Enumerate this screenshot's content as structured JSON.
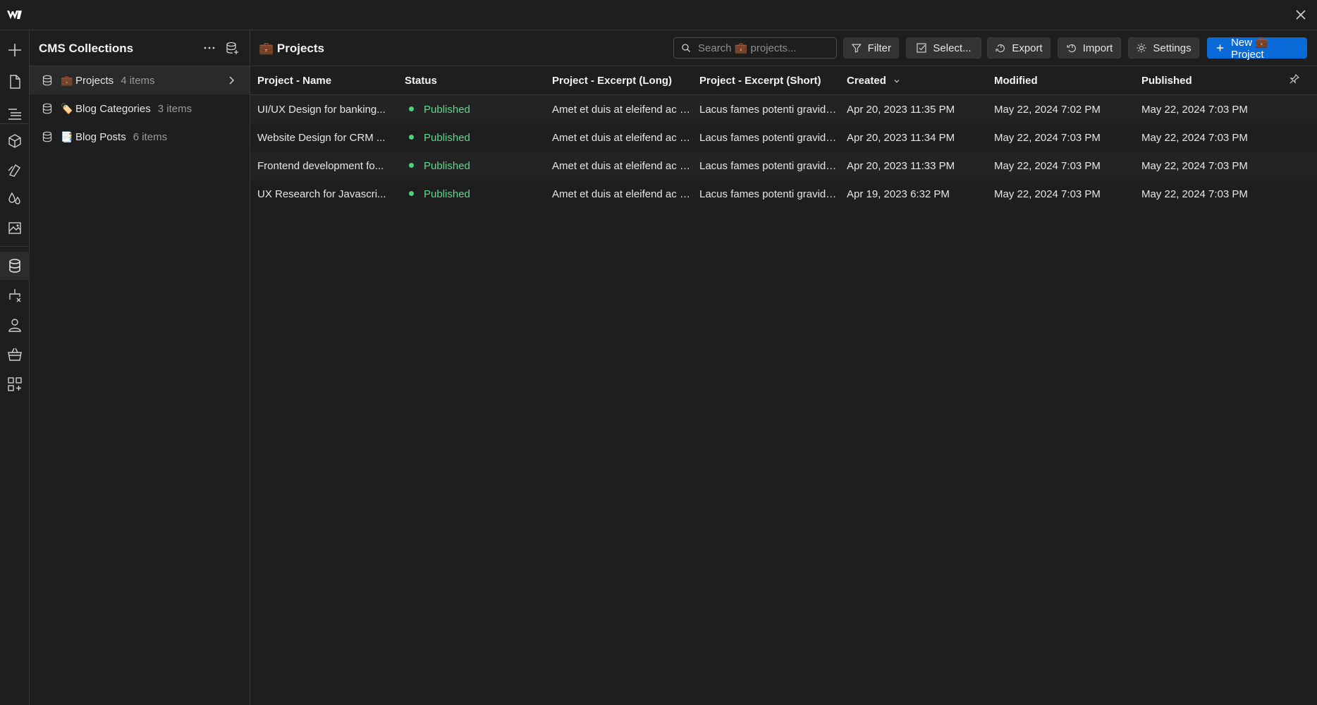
{
  "app": {
    "logo_text": "W",
    "colors": {
      "accent": "#0a6bd8",
      "status_published": "#4bd37b",
      "bg": "#1e1e1e"
    }
  },
  "rail": {
    "icons": [
      "add-icon",
      "page-icon",
      "navigator-icon",
      "components-icon",
      "style-icon",
      "variables-icon",
      "assets-icon",
      "cms-icon",
      "logic-icon",
      "users-icon",
      "ecommerce-icon",
      "apps-icon"
    ]
  },
  "collections": {
    "title": "CMS Collections",
    "items": [
      {
        "emoji": "💼",
        "name": "Projects",
        "count": "4 items"
      },
      {
        "emoji": "🏷️",
        "name": "Blog Categories",
        "count": "3 items"
      },
      {
        "emoji": "📑",
        "name": "Blog Posts",
        "count": "6 items"
      }
    ]
  },
  "main": {
    "title": "💼 Projects",
    "search_placeholder": "Search 💼 projects...",
    "buttons": {
      "filter": "Filter",
      "select": "Select...",
      "export": "Export",
      "import": "Import",
      "settings": "Settings",
      "new": "New 💼 Project"
    }
  },
  "table": {
    "columns": [
      "Project - Name",
      "Status",
      "Project - Excerpt (Long)",
      "Project - Excerpt (Short)",
      "Created",
      "Modified",
      "Published"
    ],
    "rows": [
      {
        "name": "UI/UX Design for banking...",
        "status": "Published",
        "excerpt_long": "Amet et duis at eleifend ac la...",
        "excerpt_short": "Lacus fames potenti gravida l...",
        "created": "Apr 20, 2023 11:35 PM",
        "modified": "May 22, 2024 7:02 PM",
        "published": "May 22, 2024 7:03 PM"
      },
      {
        "name": "Website Design for CRM ...",
        "status": "Published",
        "excerpt_long": "Amet et duis at eleifend ac la...",
        "excerpt_short": "Lacus fames potenti gravida l...",
        "created": "Apr 20, 2023 11:34 PM",
        "modified": "May 22, 2024 7:03 PM",
        "published": "May 22, 2024 7:03 PM"
      },
      {
        "name": "Frontend development fo...",
        "status": "Published",
        "excerpt_long": "Amet et duis at eleifend ac la...",
        "excerpt_short": "Lacus fames potenti gravida l...",
        "created": "Apr 20, 2023 11:33 PM",
        "modified": "May 22, 2024 7:03 PM",
        "published": "May 22, 2024 7:03 PM"
      },
      {
        "name": "UX Research for Javascri...",
        "status": "Published",
        "excerpt_long": "Amet et duis at eleifend ac la...",
        "excerpt_short": "Lacus fames potenti gravida l...",
        "created": "Apr 19, 2023 6:32 PM",
        "modified": "May 22, 2024 7:03 PM",
        "published": "May 22, 2024 7:03 PM"
      }
    ]
  }
}
